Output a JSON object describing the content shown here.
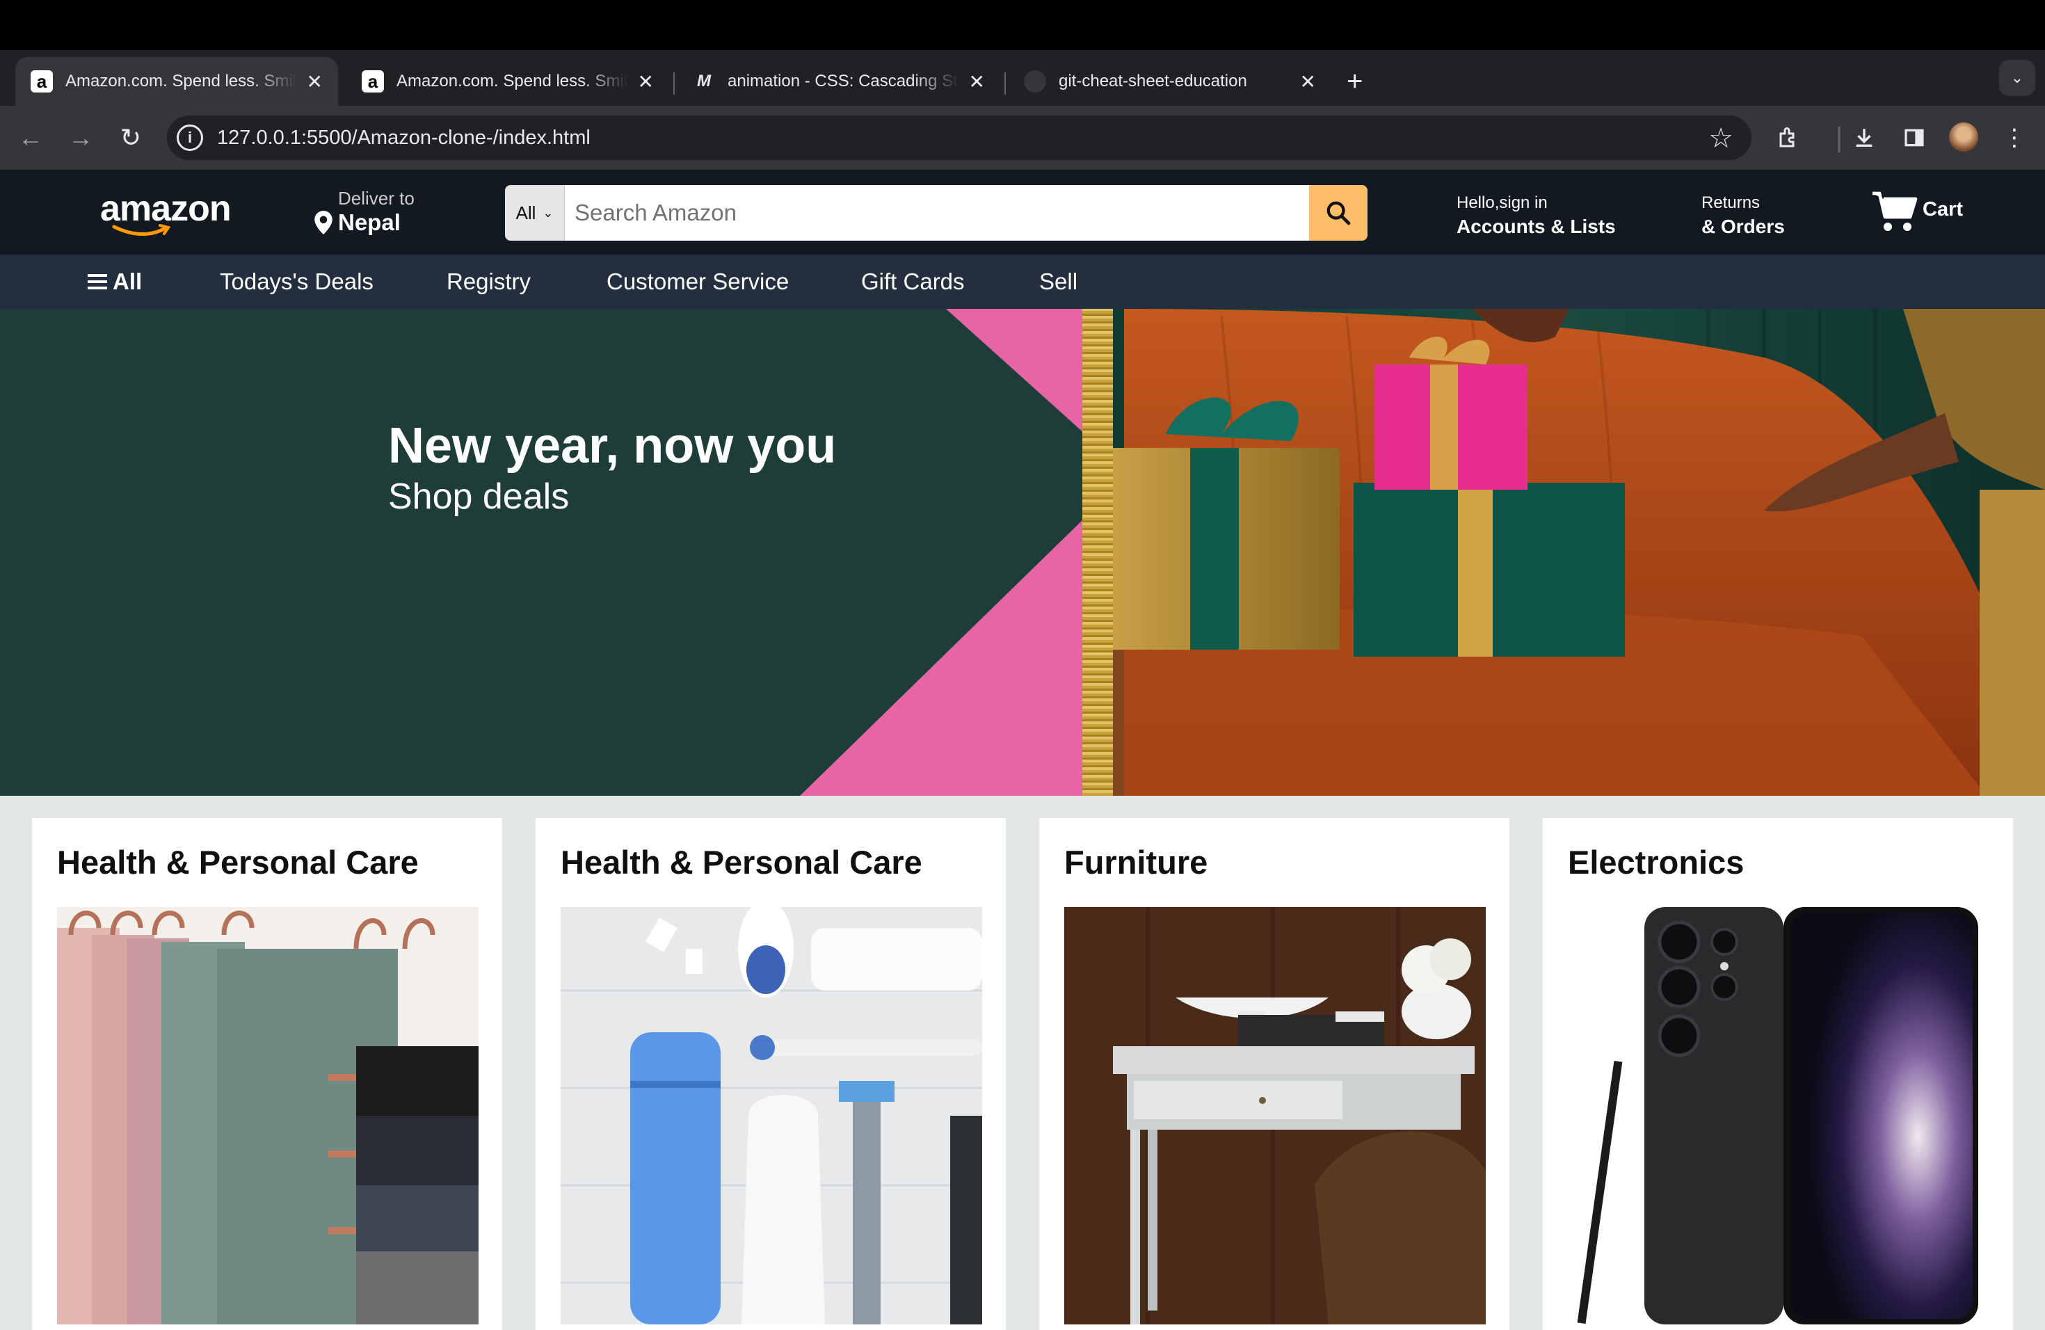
{
  "browser": {
    "tabs": [
      {
        "title": "Amazon.com. Spend less. Smile more.",
        "active": true,
        "favicon": "amazon-a"
      },
      {
        "title": "Amazon.com. Spend less. Smile more.",
        "active": false,
        "favicon": "amazon-a"
      },
      {
        "title": "animation - CSS: Cascading Style Sheets",
        "active": false,
        "favicon": "mdn"
      },
      {
        "title": "git-cheat-sheet-education",
        "active": false,
        "favicon": "github"
      }
    ],
    "url": "127.0.0.1:5500/Amazon-clone-/index.html"
  },
  "header": {
    "logo": "amazon",
    "deliver_line1": "Deliver to",
    "deliver_line2": "Nepal",
    "search_category": "All",
    "search_placeholder": "Search Amazon",
    "account_line1": "Hello,sign in",
    "account_line2": "Accounts & Lists",
    "orders_line1": "Returns",
    "orders_line2": "& Orders",
    "cart_label": "Cart"
  },
  "subnav": {
    "all": "All",
    "items": [
      "Todays's Deals",
      "Registry",
      "Customer Service",
      "Gift Cards",
      "Sell"
    ]
  },
  "hero": {
    "title": "New year, now you",
    "subtitle": "Shop deals"
  },
  "cards": [
    {
      "title": "Health & Personal Care",
      "image": "folded-towels"
    },
    {
      "title": "Health & Personal Care",
      "image": "personal-care-items"
    },
    {
      "title": "Furniture",
      "image": "white-desk"
    },
    {
      "title": "Electronics",
      "image": "samsung-phone"
    }
  ],
  "colors": {
    "header_bg": "#131921",
    "subnav_bg": "#232f3e",
    "search_button": "#febd69",
    "hero_green": "#1e3d38",
    "hero_pink": "#e865a5",
    "page_bg": "#e3e6e6"
  }
}
